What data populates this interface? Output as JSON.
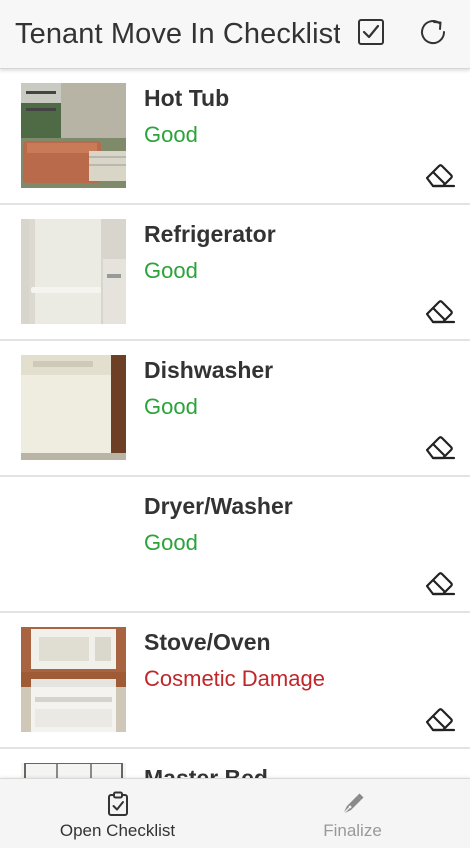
{
  "header": {
    "title": "Tenant Move In Checklist",
    "check_icon": "checkbox-check-icon",
    "refresh_icon": "refresh-icon"
  },
  "colors": {
    "good": "#2aa33a",
    "damage": "#c0262a",
    "header_bg": "#f7f7f7",
    "tab_inactive": "#999999"
  },
  "items": [
    {
      "name": "Hot Tub",
      "condition": "Good",
      "status": "good",
      "photo": "hot-tub-photo"
    },
    {
      "name": "Refrigerator",
      "condition": "Good",
      "status": "good",
      "photo": "refrigerator-photo"
    },
    {
      "name": "Dishwasher",
      "condition": "Good",
      "status": "good",
      "photo": "dishwasher-photo"
    },
    {
      "name": "Dryer/Washer",
      "condition": "Good",
      "status": "good",
      "photo": ""
    },
    {
      "name": "Stove/Oven",
      "condition": "Cosmetic Damage",
      "status": "damage",
      "photo": "stove-oven-photo"
    },
    {
      "name": "Master Bed",
      "condition": "",
      "status": "good",
      "photo": "master-bed-photo"
    }
  ],
  "bottom_tabs": {
    "open_checklist": {
      "label": "Open Checklist",
      "icon": "clipboard-check-icon"
    },
    "finalize": {
      "label": "Finalize",
      "icon": "pen-nib-icon"
    }
  }
}
